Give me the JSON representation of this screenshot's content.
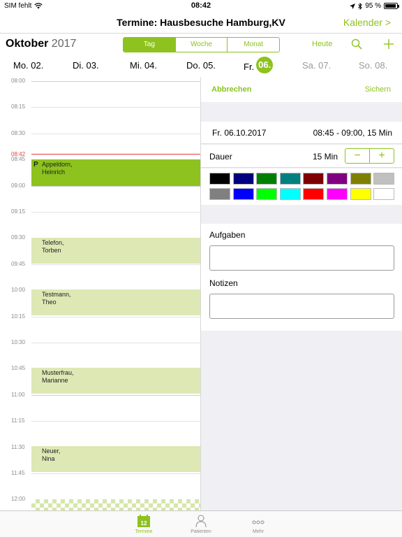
{
  "status": {
    "carrier": "SIM fehlt",
    "time": "08:42",
    "battery": "95 %",
    "battery_level": 0.95
  },
  "nav": {
    "title": "Termine: Hausbesuche Hamburg,KV",
    "right_link": "Kalender >"
  },
  "toolbar": {
    "month": "Oktober",
    "year": "2017",
    "segments": [
      "Tag",
      "Woche",
      "Monat"
    ],
    "active_segment": "Tag",
    "heute": "Heute"
  },
  "days": [
    {
      "label": "Mo. 02."
    },
    {
      "label": "Di. 03."
    },
    {
      "label": "Mi. 04."
    },
    {
      "label": "Do. 05."
    },
    {
      "prefix": "Fr.",
      "num": "06."
    },
    {
      "label": "Sa. 07."
    },
    {
      "label": "So. 08."
    }
  ],
  "calendar": {
    "times": [
      "08:00",
      "08:15",
      "08:30",
      "08:45",
      "09:00",
      "09:15",
      "09:30",
      "09:45",
      "10:00",
      "10:15",
      "10:30",
      "10:45",
      "11:00",
      "11:15",
      "11:30",
      "11:45",
      "12:00"
    ],
    "now": "08:42",
    "events": [
      {
        "badge": "P",
        "line1": "Appeldorn,",
        "line2": "Heinrich"
      },
      {
        "line1": "Telefon,",
        "line2": "Torben"
      },
      {
        "line1": "Testmann,",
        "line2": "Theo"
      },
      {
        "line1": "Musterfrau,",
        "line2": "Marianne"
      },
      {
        "line1": "Neuer,",
        "line2": "Nina"
      }
    ]
  },
  "panel": {
    "cancel": "Abbrechen",
    "save": "Sichern",
    "date": "Fr. 06.10.2017",
    "time_range": "08:45 - 09:00, 15 Min",
    "duration_label": "Dauer",
    "duration_value": "15 Min",
    "minus": "−",
    "plus": "+",
    "colors": [
      "#000000",
      "#000080",
      "#008000",
      "#008080",
      "#800000",
      "#800080",
      "#808000",
      "#c0c0c0",
      "#808080",
      "#0000ff",
      "#00ff00",
      "#00ffff",
      "#ff0000",
      "#ff00ff",
      "#ffff00",
      "#ffffff"
    ],
    "aufgaben_label": "Aufgaben",
    "notizen_label": "Notizen"
  },
  "tabs": [
    {
      "label": "Termine",
      "badge": "12"
    },
    {
      "label": "Patienten"
    },
    {
      "label": "Mehr"
    }
  ],
  "accent": "#8dc21f"
}
